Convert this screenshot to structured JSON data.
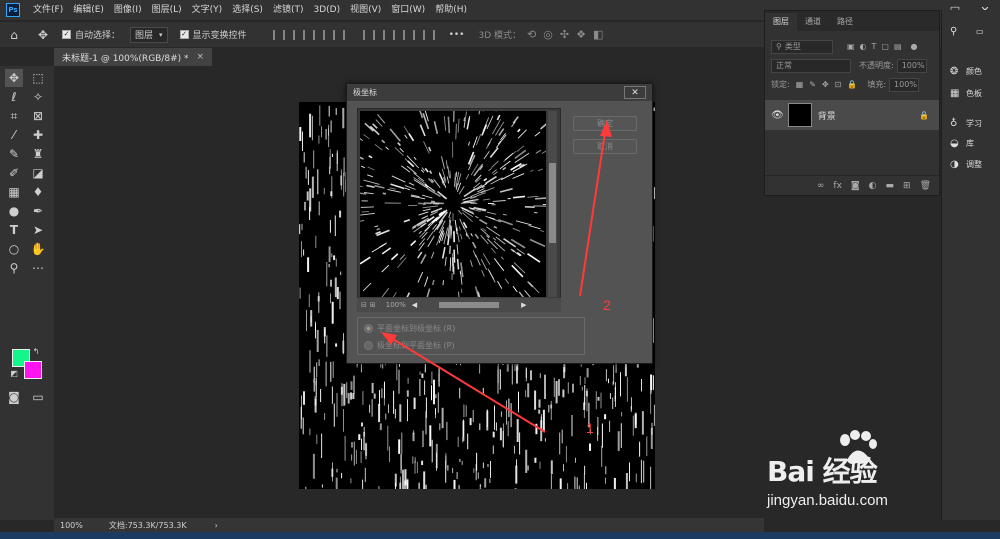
{
  "app": {
    "logo_text": "Ps"
  },
  "menubar": {
    "items": [
      "文件(F)",
      "编辑(E)",
      "图像(I)",
      "图层(L)",
      "文字(Y)",
      "选择(S)",
      "滤镜(T)",
      "3D(D)",
      "视图(V)",
      "窗口(W)",
      "帮助(H)"
    ]
  },
  "window_controls": {
    "minimize": "—",
    "maximize": "□",
    "close": "✕"
  },
  "optbar": {
    "auto_select_label": "自动选择：",
    "auto_select_target": "图层",
    "show_transform_label": "显示变换控件",
    "more": "•••",
    "mode3d_label": "3D 模式："
  },
  "document": {
    "tab_title": "未标题-1 @ 100%(RGB/8#) *",
    "tab_close": "×",
    "zoom_status": "100%",
    "doc_info": "文档:753.3K/753.3K",
    "status_arrow": "›"
  },
  "layers_panel": {
    "tabs": [
      "图层",
      "通道",
      "路径"
    ],
    "filter_kind": "类型",
    "blend_mode": "正常",
    "opacity_label": "不透明度:",
    "opacity_value": "100%",
    "lock_label": "锁定:",
    "fill_label": "填充:",
    "fill_value": "100%",
    "layer_name": "背景"
  },
  "right_dock": {
    "items": [
      "颜色",
      "色板",
      "学习",
      "库",
      "调整"
    ]
  },
  "polar_dialog": {
    "title": "极坐标",
    "close_symbol": "✕",
    "ok_label": "确定",
    "cancel_label": "取消",
    "zoom_value": "100%",
    "option1": "平面坐标到极坐标 (R)",
    "option2": "极坐标到平面坐标 (P)",
    "option1_selected": true
  },
  "annotations": {
    "step1": "1",
    "step2": "2",
    "arrow_color": "#ff3a3a"
  },
  "watermark": {
    "brand": "Bai  经验",
    "url": "jingyan.baidu.com"
  },
  "colors": {
    "foreground": "#14f58a",
    "background": "#ff14f0",
    "accent": "#31a8ff"
  }
}
